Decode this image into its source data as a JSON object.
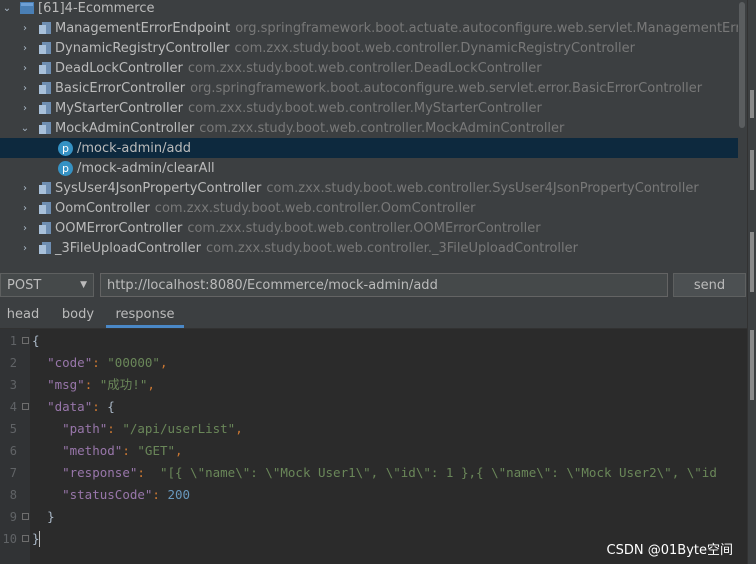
{
  "tree": {
    "root": {
      "label": "[61]4-Ecommerce"
    },
    "items": [
      {
        "name": "ManagementErrorEndpoint",
        "package": "org.springframework.boot.actuate.autoconfigure.web.servlet.ManagementErrorEndpoint"
      },
      {
        "name": "DynamicRegistryController",
        "package": "com.zxx.study.boot.web.controller.DynamicRegistryController"
      },
      {
        "name": "DeadLockController",
        "package": "com.zxx.study.boot.web.controller.DeadLockController"
      },
      {
        "name": "BasicErrorController",
        "package": "org.springframework.boot.autoconfigure.web.servlet.error.BasicErrorController"
      },
      {
        "name": "MyStarterController",
        "package": "com.zxx.study.boot.web.controller.MyStarterController"
      },
      {
        "name": "MockAdminController",
        "package": "com.zxx.study.boot.web.controller.MockAdminController"
      },
      {
        "name": "SysUser4JsonPropertyController",
        "package": "com.zxx.study.boot.web.controller.SysUser4JsonPropertyController"
      },
      {
        "name": "OomController",
        "package": "com.zxx.study.boot.web.controller.OomController"
      },
      {
        "name": "OOMErrorController",
        "package": "com.zxx.study.boot.web.controller.OOMErrorController"
      },
      {
        "name": "_3FileUploadController",
        "package": "com.zxx.study.boot.web.controller._3FileUploadController"
      }
    ],
    "endpoints": [
      {
        "icon": "p",
        "path": "/mock-admin/add"
      },
      {
        "icon": "p",
        "path": "/mock-admin/clearAll"
      }
    ]
  },
  "request": {
    "method": "POST",
    "method_caret": "▼",
    "url": "http://localhost:8080/Ecommerce/mock-admin/add",
    "send_label": "send"
  },
  "tabs": [
    {
      "label": "head"
    },
    {
      "label": "body"
    },
    {
      "label": "response",
      "active": true
    }
  ],
  "editor": {
    "line_numbers": [
      "1",
      "2",
      "3",
      "4",
      "5",
      "6",
      "7",
      "8",
      "9",
      "10"
    ],
    "lines": {
      "l1_brace": "{",
      "l2_key": "\"code\"",
      "l2_val": "\"00000\"",
      "l3_key": "\"msg\"",
      "l3_val": "\"成功!\"",
      "l4_key": "\"data\"",
      "l4_brace": "{",
      "l5_key": "\"path\"",
      "l5_val": "\"/api/userList\"",
      "l6_key": "\"method\"",
      "l6_val": "\"GET\"",
      "l7_key": "\"response\"",
      "l7_val": "\"[{ \\\"name\\\": \\\"Mock User1\\\", \\\"id\\\": 1 },{ \\\"name\\\": \\\"Mock User2\\\", \\\"id",
      "l8_key": "\"statusCode\"",
      "l8_val": "200",
      "l9_brace": "}",
      "l10_brace": "}"
    }
  },
  "watermark": "CSDN @01Byte空间",
  "colors": {
    "accent": "#4a88c7",
    "selection": "#0d293e",
    "endpoint_icon": "#3592c4",
    "json_key": "#9876aa",
    "json_string": "#6a8759",
    "json_number": "#6897bb"
  }
}
